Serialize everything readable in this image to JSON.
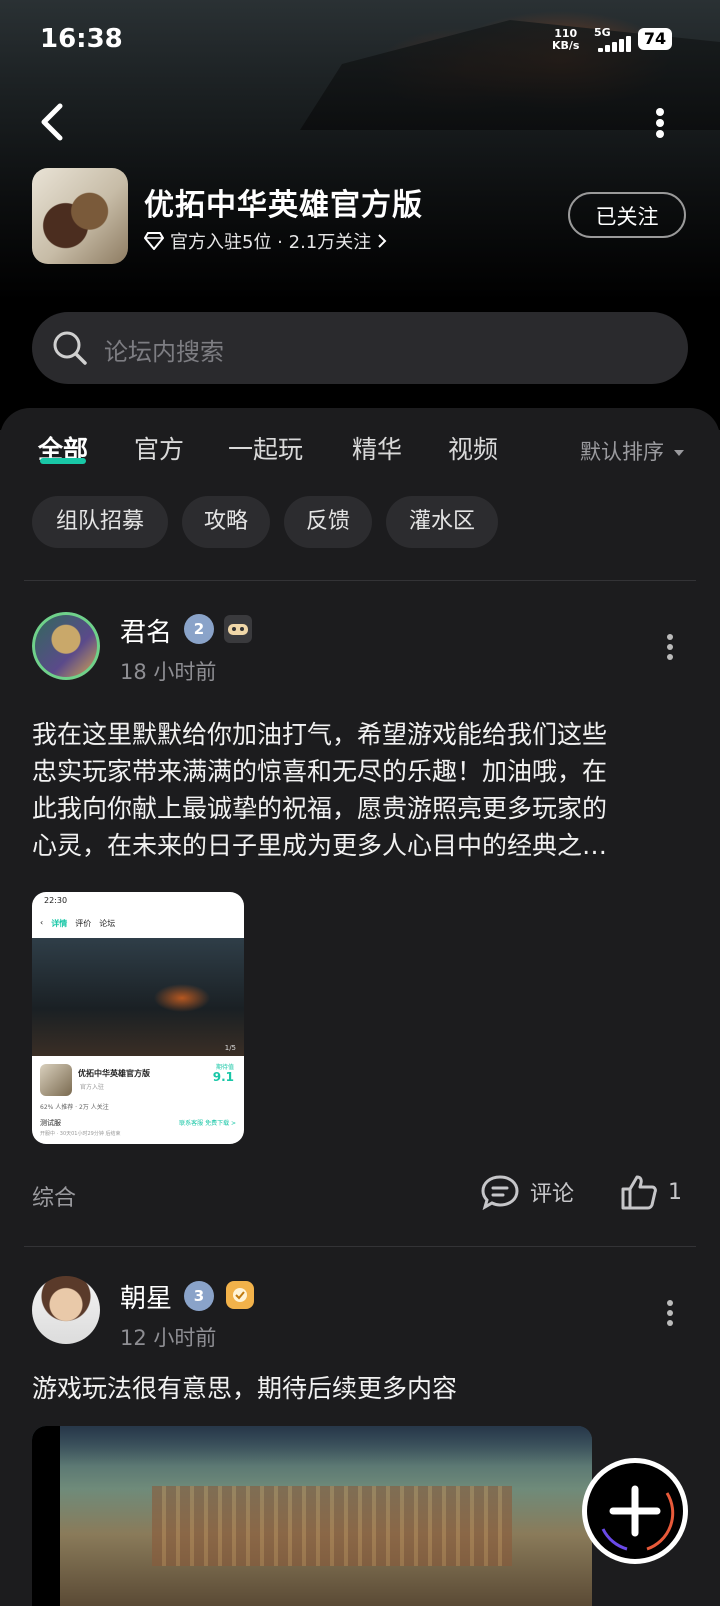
{
  "status_bar": {
    "time": "16:38",
    "speed_value": "110",
    "speed_unit": "KB/s",
    "network": "5G",
    "battery": "74"
  },
  "header": {
    "app_name": "优拓中华英雄官方版",
    "meta": "官方入驻5位 · 2.1万关注",
    "follow_label": "已关注",
    "back_icon": "chevron-left-icon",
    "more_icon": "more-vertical-icon"
  },
  "search": {
    "placeholder": "论坛内搜索",
    "icon": "search-icon"
  },
  "tabs": [
    {
      "label": "全部",
      "active": true
    },
    {
      "label": "官方",
      "active": false
    },
    {
      "label": "一起玩",
      "active": false
    },
    {
      "label": "精华",
      "active": false
    },
    {
      "label": "视频",
      "active": false
    }
  ],
  "sort_label": "默认排序",
  "chips": [
    "组队招募",
    "攻略",
    "反馈",
    "灌水区"
  ],
  "accent_color": "#19c7a7",
  "posts": [
    {
      "author": "君名",
      "level": "2",
      "time": "18 小时前",
      "text_lines": [
        "我在这里默默给你加油打气，希望游戏能给我们这些",
        "忠实玩家带来满满的惊喜和无尽的乐趣！加油哦，在",
        "此我向你献上最诚挚的祝福，愿贵游照亮更多玩家的",
        "心灵，在未来的日子里成为更多人心目中的经典之…"
      ],
      "image": {
        "status_time": "22:30",
        "tab_detail": "详情",
        "tab_review": "评价",
        "tab_forum": "论坛",
        "counter": "1/5",
        "game_name": "优拓中华英雄官方版",
        "score_label": "期待值",
        "score": "9.1",
        "official": "官方入驻",
        "stats": "62% 人推荐 · 2万 人关注",
        "test_label": "测试服",
        "test_action": "联系客服 免费下载 >",
        "test_note": "开服中 · 30天01小时29分钟 后结束"
      },
      "category": "综合",
      "comment_label": "评论",
      "like_count": "1"
    },
    {
      "author": "朝星",
      "level": "3",
      "time": "12 小时前",
      "text_lines": [
        "游戏玩法很有意思，期待后续更多内容"
      ]
    }
  ]
}
